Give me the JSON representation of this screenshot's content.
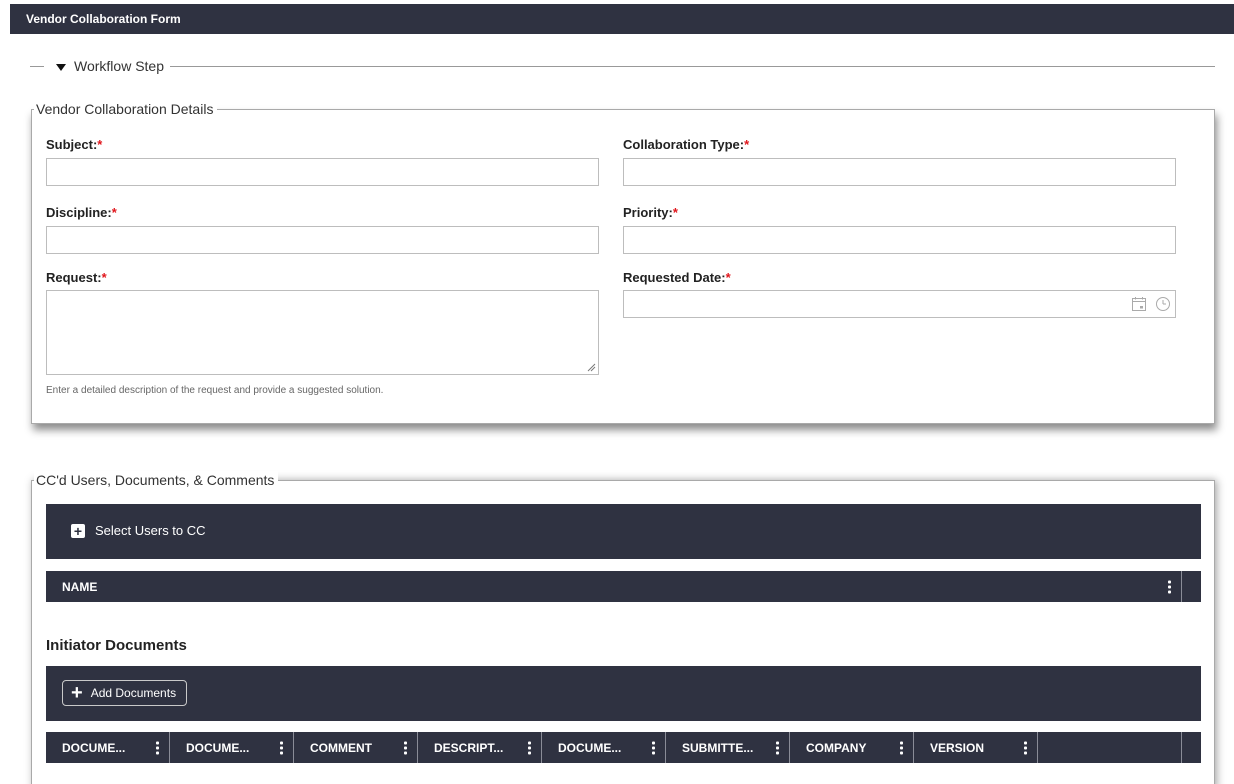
{
  "window": {
    "title": "Vendor Collaboration Form"
  },
  "workflow": {
    "label": "Workflow Step"
  },
  "details": {
    "legend": "Vendor Collaboration Details",
    "fields": {
      "subject": {
        "label": "Subject:",
        "required": "*",
        "value": ""
      },
      "collaboration_type": {
        "label": "Collaboration Type:",
        "required": "*",
        "value": ""
      },
      "discipline": {
        "label": "Discipline:",
        "required": "*",
        "value": ""
      },
      "priority": {
        "label": "Priority:",
        "required": "*",
        "value": ""
      },
      "request": {
        "label": "Request:",
        "required": "*",
        "value": "",
        "hint": "Enter a detailed description of the request and provide a suggested solution."
      },
      "requested_date": {
        "label": "Requested Date:",
        "required": "*",
        "value": ""
      }
    },
    "icons": {
      "calendar": "calendar-icon",
      "clock": "clock-icon"
    }
  },
  "cc": {
    "legend": "CC'd Users, Documents, & Comments",
    "select_button": "Select Users to CC",
    "columns": [
      "NAME"
    ]
  },
  "documents": {
    "title": "Initiator Documents",
    "add_button": "Add Documents",
    "columns": [
      "DOCUME...",
      "DOCUME...",
      "COMMENT",
      "DESCRIPT...",
      "DOCUME...",
      "SUBMITTE...",
      "COMPANY",
      "VERSION"
    ]
  },
  "colors": {
    "header_bg": "#2f3241",
    "required": "#e0151b"
  }
}
